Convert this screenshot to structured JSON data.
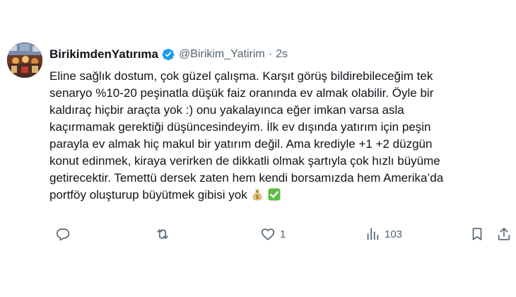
{
  "tweet": {
    "display_name": "BirikimdenYatırıma",
    "handle": "@Birikim_Yatirim",
    "separator": "·",
    "time": "2s",
    "verified": true,
    "text_lines": [
      "Eline sağlık dostum, çok güzel çalışma. Karşıt görüş bildirebileceğim tek",
      "senaryo %10-20 peşinatla düşük faiz oranında ev almak olabilir. Öyle bir",
      "kaldıraç hiçbir araçta yok :) onu yakalayınca eğer imkan varsa asla",
      "kaçırmamak gerektiği düşüncesindeyim. İlk ev dışında yatırım için peşin",
      "parayla ev almak hiç makul bir yatırım değil. Ama krediyle +1 +2 düzgün",
      "konut edinmek, kiraya verirken de dikkatli olmak şartıyla çok hızlı büyüme",
      "getirecektir. Temettü dersek zaten hem kendi borsamızda hem Amerika’da",
      "portföy oluşturup büyütmek gibisi yok"
    ],
    "emojis": [
      "money-bag-icon",
      "check-mark-button-icon"
    ]
  },
  "actions": {
    "reply_count": "",
    "retweet_count": "",
    "like_count": "1",
    "views_count": "103"
  },
  "colors": {
    "text": "#0f1419",
    "secondary": "#536471",
    "verified_blue": "#1d9bf0",
    "check_green": "#5fbb46"
  }
}
